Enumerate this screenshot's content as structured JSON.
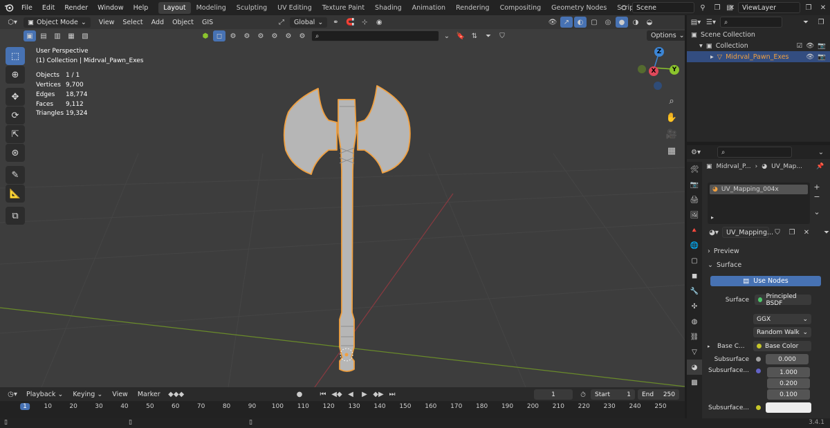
{
  "topbar": {
    "menus": [
      "File",
      "Edit",
      "Render",
      "Window",
      "Help"
    ],
    "workspaces": [
      "Layout",
      "Modeling",
      "Sculpting",
      "UV Editing",
      "Texture Paint",
      "Shading",
      "Animation",
      "Rendering",
      "Compositing",
      "Geometry Nodes",
      "Scripting"
    ],
    "active_workspace": "Layout",
    "add_tab": "+",
    "scene": "Scene",
    "view_layer": "ViewLayer"
  },
  "viewport_header": {
    "mode": "Object Mode",
    "menus": [
      "View",
      "Select",
      "Add",
      "Object",
      "GIS"
    ],
    "orientation": "Global",
    "options": "Options"
  },
  "overlay": {
    "view_name": "User Perspective",
    "collection_line": "(1) Collection | Midrval_Pawn_Exes",
    "stats": [
      {
        "k": "Objects",
        "v": "1 / 1"
      },
      {
        "k": "Vertices",
        "v": "9,700"
      },
      {
        "k": "Edges",
        "v": "18,774"
      },
      {
        "k": "Faces",
        "v": "9,112"
      },
      {
        "k": "Triangles",
        "v": "19,324"
      }
    ]
  },
  "gizmo": {
    "z": "Z",
    "x": "X",
    "y": "Y"
  },
  "outliner": {
    "scene_collection": "Scene Collection",
    "collection": "Collection",
    "object": "Midrval_Pawn_Exes"
  },
  "properties": {
    "breadcrumb_object": "Midrval_P...",
    "breadcrumb_material": "UV_Map...",
    "slot": "UV_Mapping_004x",
    "material_name": "UV_Mapping...",
    "preview": "Preview",
    "surface_panel": "Surface",
    "use_nodes": "Use Nodes",
    "surface_label": "Surface",
    "surface_value": "Principled BSDF",
    "distribution": "GGX",
    "subsurface_method": "Random Walk",
    "base_color_label": "Base C...",
    "base_color_value": "Base Color",
    "subsurface_label": "Subsurface",
    "subsurface_value": "0.000",
    "subsurface_radius_label": "Subsurface...",
    "radius": [
      "1.000",
      "0.200",
      "0.100"
    ],
    "subsurface_color_label": "Subsurface..."
  },
  "timeline": {
    "menus": [
      "Playback",
      "Keying",
      "View",
      "Marker"
    ],
    "current_frame": "1",
    "start_label": "Start",
    "start": "1",
    "end_label": "End",
    "end": "250",
    "ticks": [
      "1",
      "10",
      "20",
      "30",
      "40",
      "50",
      "60",
      "70",
      "80",
      "90",
      "100",
      "110",
      "120",
      "130",
      "140",
      "150",
      "160",
      "170",
      "180",
      "190",
      "200",
      "210",
      "220",
      "230",
      "240",
      "250"
    ]
  },
  "status": {
    "version": "3.4.1"
  },
  "colors": {
    "accent": "#4772b3",
    "selection": "#f0a040",
    "x_axis": "#e0485a",
    "y_axis": "#8bc42d",
    "z_axis": "#3c86d6"
  }
}
